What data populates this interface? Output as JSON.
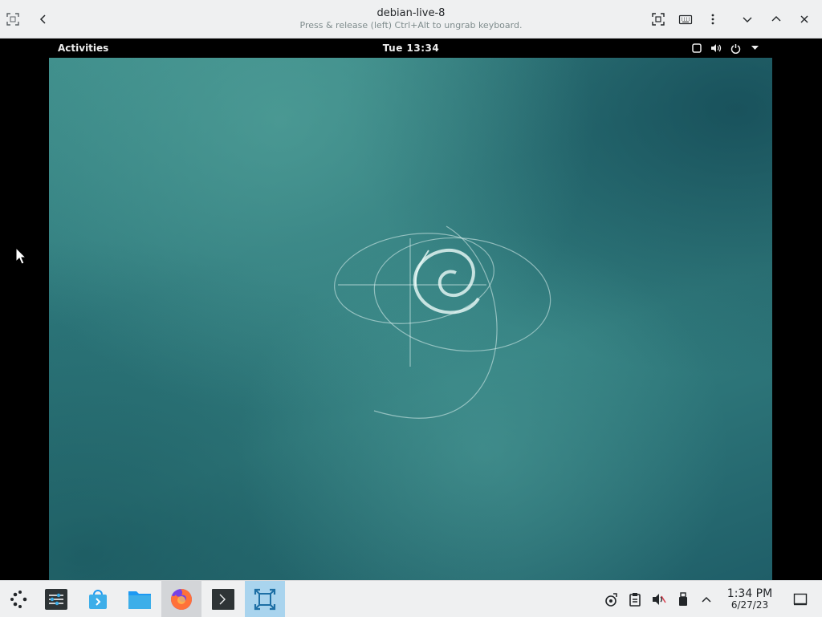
{
  "host_window": {
    "title": "debian-live-8",
    "subtitle": "Press & release (left) Ctrl+Alt to ungrab keyboard."
  },
  "guest": {
    "topbar": {
      "activities": "Activities",
      "clock": "Tue 13:34"
    }
  },
  "taskbar": {
    "tray_clock": {
      "time": "1:34 PM",
      "date": "6/27/23"
    }
  },
  "colors": {
    "host_bar": "#eff0f1",
    "wallpaper_teal": "#2f7a7d",
    "taskbar_selected": "#a9d4ee"
  }
}
